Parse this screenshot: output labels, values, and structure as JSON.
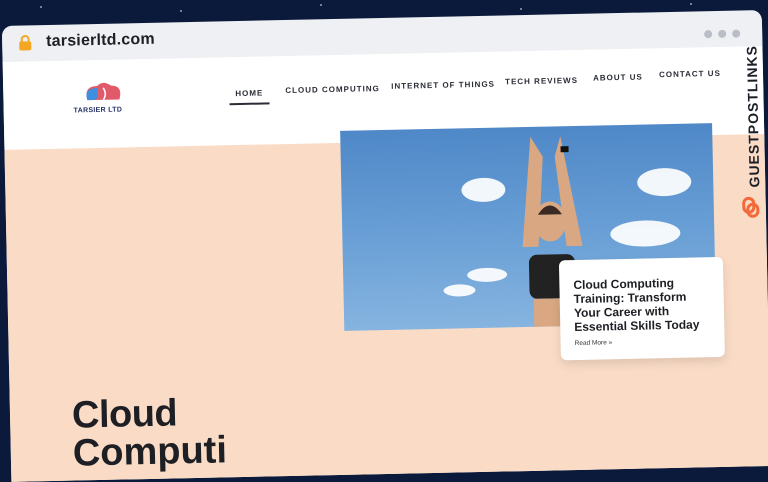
{
  "browser": {
    "url": "tarsierltd.com"
  },
  "site": {
    "logo_text": "TARSIER LTD",
    "nav": [
      "HOME",
      "CLOUD COMPUTING",
      "INTERNET OF THINGS",
      "TECH REVIEWS",
      "ABOUT US",
      "CONTACT US"
    ],
    "active_nav": "HOME"
  },
  "hero": {
    "card_title": "Cloud Computing Training: Transform Your Career with Essential Skills Today",
    "card_link": "Read More »",
    "heading_line1": "Cloud",
    "heading_line2": "Computi"
  },
  "badge": {
    "label": "GUESTPOSTLINKS"
  },
  "colors": {
    "accent": "#f26a3a",
    "hero_bg": "#fadcc6",
    "sky": "#5b92cf"
  },
  "icons": [
    "lock-icon",
    "logo-icon",
    "chain-link-icon"
  ]
}
